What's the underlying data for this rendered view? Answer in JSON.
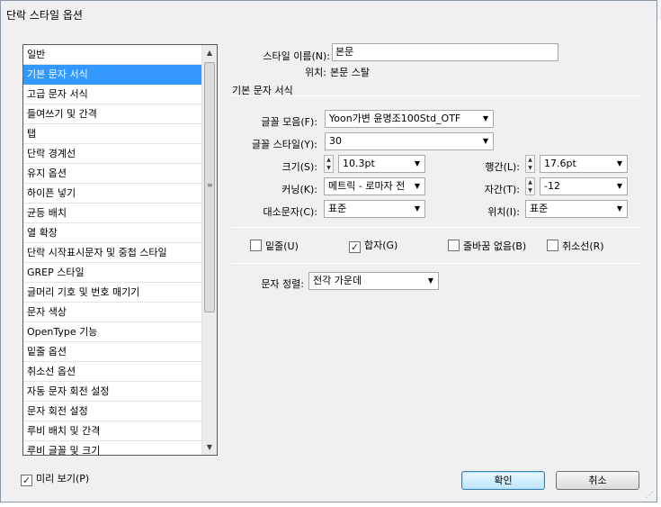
{
  "dialog": {
    "title": "단락 스타일 옵션"
  },
  "categories": [
    "일반",
    "기본 문자 서식",
    "고급 문자 서식",
    "들여쓰기 및 간격",
    "탭",
    "단락 경계선",
    "유지 옵션",
    "하이픈 넣기",
    "균등 배치",
    "열 확장",
    "단락 시작표시문자 및 중첩 스타일",
    "GREP 스타일",
    "글머리 기호 및 번호 매기기",
    "문자 색상",
    "OpenType 기능",
    "밑줄 옵션",
    "취소선 옵션",
    "자동 문자 회전 설정",
    "문자 회전 설정",
    "루비 배치 및 간격",
    "루비 글꼴 및 크기"
  ],
  "selected_index": 1,
  "style": {
    "name_label": "스타일 이름(N):",
    "name_value": "본문",
    "location_label": "위치:",
    "location_value": "본문 스탈"
  },
  "section": {
    "title": "기본 문자 서식"
  },
  "fields": {
    "font_family_label": "글꼴 모음(F):",
    "font_family_value": "Yoon가변 윤명조100Std_OTF",
    "font_style_label": "글꼴 스타일(Y):",
    "font_style_value": "30",
    "size_label": "크기(S):",
    "size_value": "10.3pt",
    "leading_label": "행간(L):",
    "leading_value": "17.6pt",
    "kerning_label": "커닝(K):",
    "kerning_value": "메트릭 - 로마자 전",
    "tracking_label": "자간(T):",
    "tracking_value": "-12",
    "case_label": "대소문자(C):",
    "case_value": "표준",
    "position_label": "위치(I):",
    "position_value": "표준"
  },
  "checkboxes": {
    "underline": {
      "label": "밑줄(U)",
      "checked": false
    },
    "ligatures": {
      "label": "합자(G)",
      "checked": true
    },
    "no_break": {
      "label": "줄바꿈 없음(B)",
      "checked": false
    },
    "strikethrough": {
      "label": "취소선(R)",
      "checked": false
    }
  },
  "alignment": {
    "label": "문자 정렬:",
    "value": "전각 가운데"
  },
  "preview": {
    "label": "미리 보기(P)",
    "checked": true
  },
  "buttons": {
    "ok": "확인",
    "cancel": "취소"
  },
  "colors": {
    "selection": "#3399ff",
    "dialog_bg": "#f0f0f0"
  }
}
